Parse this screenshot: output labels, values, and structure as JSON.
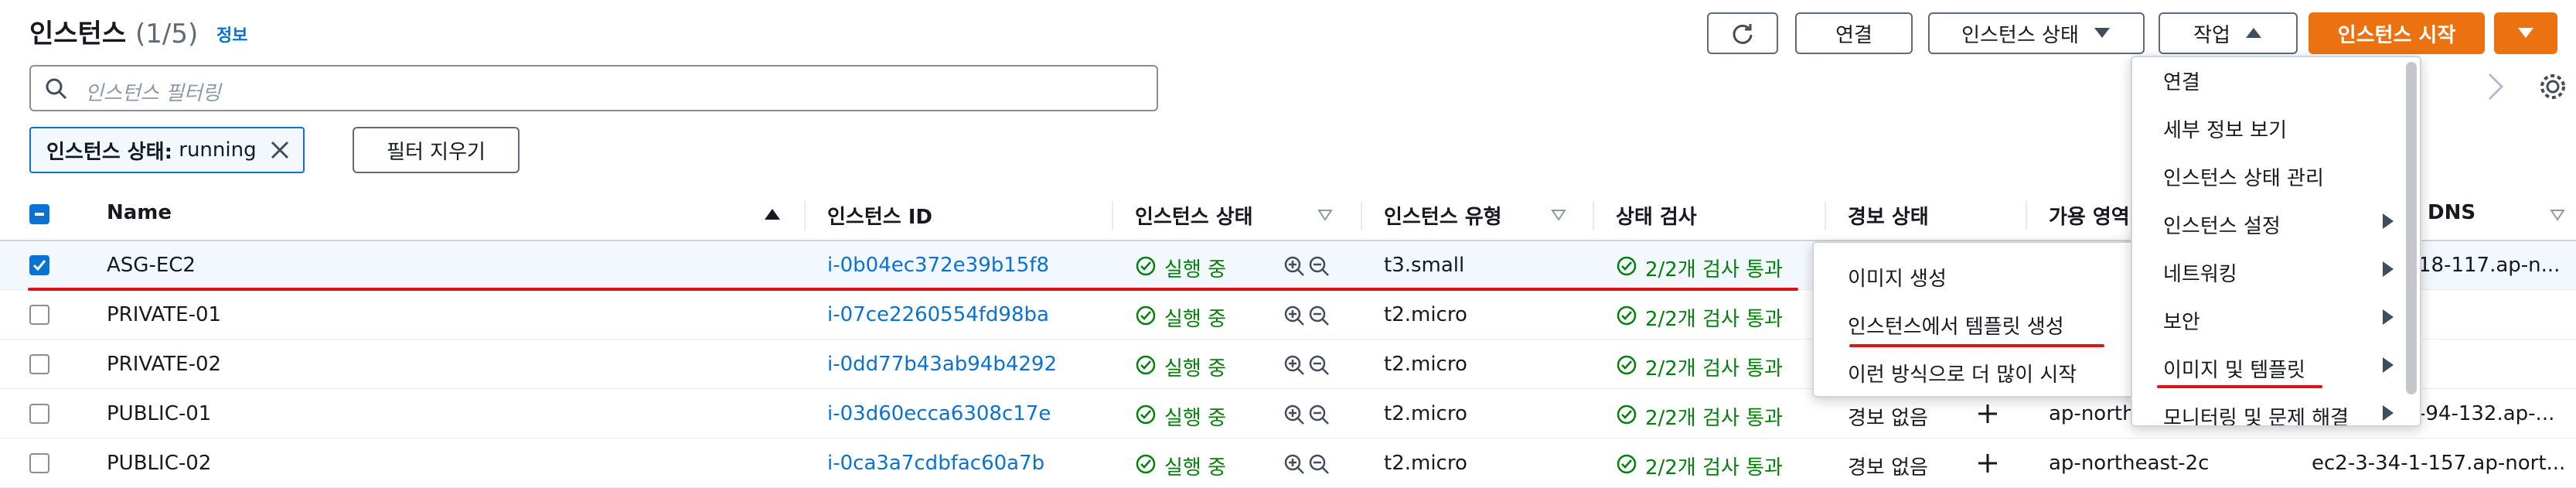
{
  "header": {
    "title": "인스턴스",
    "count": "(1/5)",
    "info": "정보"
  },
  "toolbar": {
    "connect": "연결",
    "instance_state": "인스턴스 상태",
    "actions": "작업",
    "launch": "인스턴스 시작"
  },
  "search": {
    "placeholder": "인스턴스 필터링"
  },
  "filter_token": {
    "key": "인스턴스 상태:",
    "value": "running"
  },
  "clear_filters": "필터 지우기",
  "table": {
    "columns": {
      "name": "Name",
      "id": "인스턴스 ID",
      "state": "인스턴스 상태",
      "type": "인스턴스 유형",
      "check": "상태 검사",
      "alarm": "경보 상태",
      "az": "가용 영역",
      "dns": "DNS"
    },
    "rows": [
      {
        "name": "ASG-EC2",
        "id": "i-0b04ec372e39b15f8",
        "state": "실행 중",
        "type": "t3.small",
        "check": "2/2개 검사 통과",
        "alarm": "",
        "az": "",
        "dns": "18-117.ap-n...",
        "selected": true
      },
      {
        "name": "PRIVATE-01",
        "id": "i-07ce2260554fd98ba",
        "state": "실행 중",
        "type": "t2.micro",
        "check": "2/2개 검사 통과",
        "alarm": "",
        "az": "",
        "dns": "",
        "selected": false
      },
      {
        "name": "PRIVATE-02",
        "id": "i-0dd77b43ab94b4292",
        "state": "실행 중",
        "type": "t2.micro",
        "check": "2/2개 검사 통과",
        "alarm": "",
        "az": "",
        "dns": "",
        "selected": false
      },
      {
        "name": "PUBLIC-01",
        "id": "i-03d60ecca6308c17e",
        "state": "실행 중",
        "type": "t2.micro",
        "check": "2/2개 검사 통과",
        "alarm": "경보 없음",
        "az": "ap-north",
        "dns": "-94-132.ap-...",
        "selected": false
      },
      {
        "name": "PUBLIC-02",
        "id": "i-0ca3a7cdbfac60a7b",
        "state": "실행 중",
        "type": "t2.micro",
        "check": "2/2개 검사 통과",
        "alarm": "경보 없음",
        "az": "ap-northeast-2c",
        "dns": "ec2-3-34-1-157.ap-nort...",
        "selected": false
      }
    ]
  },
  "actions_menu": {
    "items": [
      {
        "label": "연결",
        "submenu": false
      },
      {
        "label": "세부 정보 보기",
        "submenu": false
      },
      {
        "label": "인스턴스 상태 관리",
        "submenu": false
      },
      {
        "label": "인스턴스 설정",
        "submenu": true
      },
      {
        "label": "네트워킹",
        "submenu": true
      },
      {
        "label": "보안",
        "submenu": true
      },
      {
        "label": "이미지 및 템플릿",
        "submenu": true
      },
      {
        "label": "모니터링 및 문제 해결",
        "submenu": true
      }
    ]
  },
  "submenu": {
    "items": [
      {
        "label": "이미지 생성"
      },
      {
        "label": "인스턴스에서 템플릿 생성"
      },
      {
        "label": "이런 방식으로 더 많이 시작"
      }
    ]
  },
  "colors": {
    "accent": "#ec7211",
    "link": "#0972d3",
    "success": "#037f0c",
    "annotation": "#d91515"
  }
}
